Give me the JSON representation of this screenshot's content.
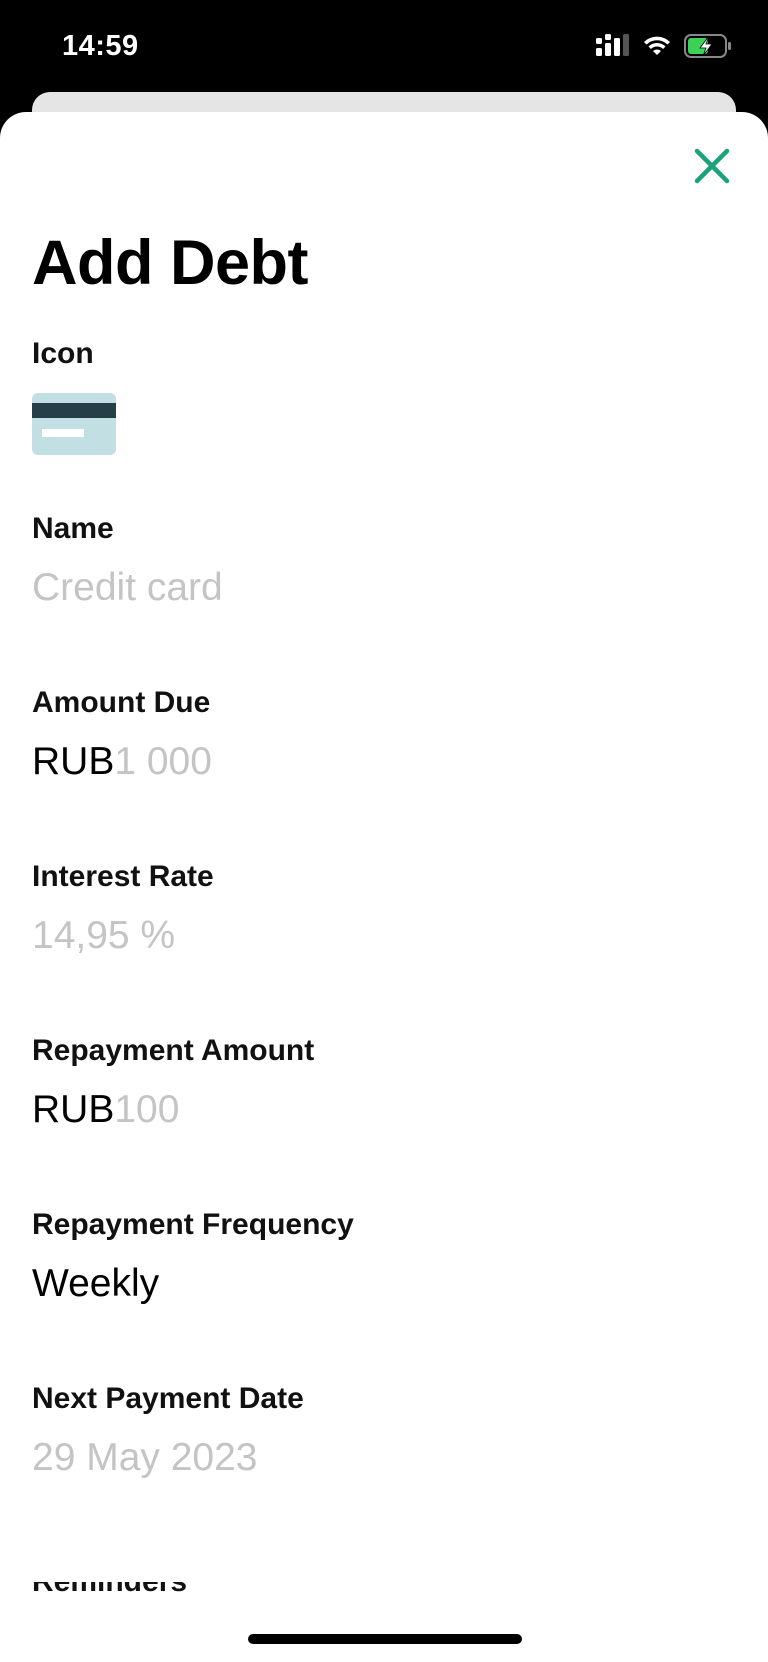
{
  "status_bar": {
    "time": "14:59",
    "signal_icon": "signal-icon",
    "wifi_icon": "wifi-icon",
    "battery_icon": "battery-charging-icon"
  },
  "sheet": {
    "close_icon": "close-icon",
    "title": "Add Debt",
    "accent_color": "#1aa37a",
    "fields": {
      "icon": {
        "label": "Icon",
        "icon_name": "credit-card-icon"
      },
      "name": {
        "label": "Name",
        "placeholder": "Credit card"
      },
      "amount_due": {
        "label": "Amount Due",
        "currency": "RUB",
        "placeholder": "1 000"
      },
      "interest_rate": {
        "label": "Interest Rate",
        "placeholder": "14,95 %"
      },
      "repayment_amount": {
        "label": "Repayment Amount",
        "currency": "RUB",
        "placeholder": "100"
      },
      "repayment_frequency": {
        "label": "Repayment Frequency",
        "value": "Weekly"
      },
      "next_payment_date": {
        "label": "Next Payment Date",
        "placeholder": "29 May 2023"
      },
      "reminders": {
        "label": "Reminders"
      }
    }
  }
}
